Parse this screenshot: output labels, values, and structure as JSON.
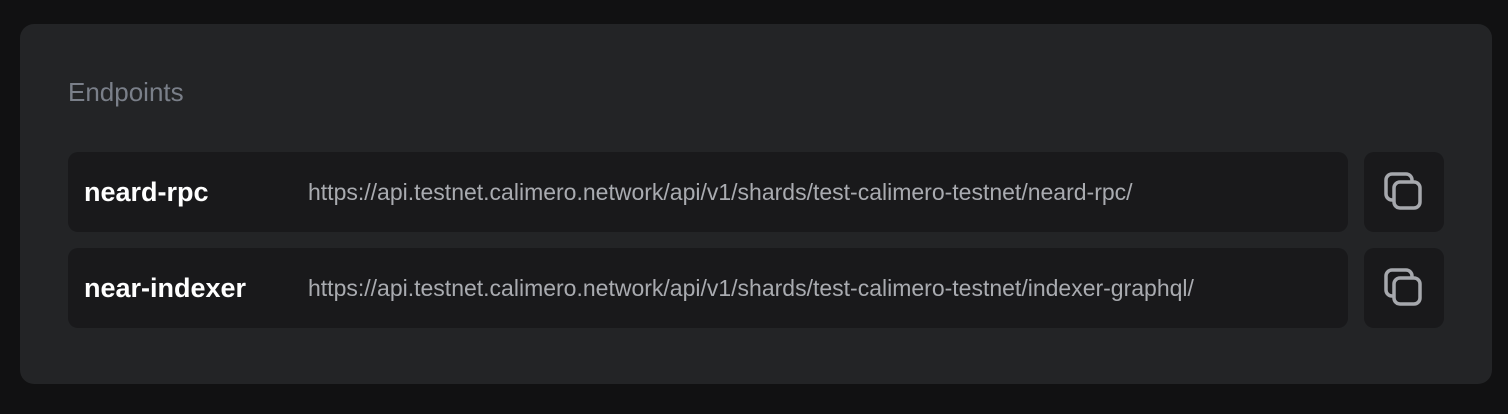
{
  "endpoints": {
    "title": "Endpoints",
    "items": [
      {
        "name": "neard-rpc",
        "url": "https://api.testnet.calimero.network/api/v1/shards/test-calimero-testnet/neard-rpc/",
        "copy_icon": "copy-icon"
      },
      {
        "name": "near-indexer",
        "url": "https://api.testnet.calimero.network/api/v1/shards/test-calimero-testnet/indexer-graphql/",
        "copy_icon": "copy-icon"
      }
    ]
  },
  "colors": {
    "page_background": "#111112",
    "panel_background": "#232426",
    "row_background": "#19191b",
    "title_text": "#7a7f89",
    "name_text": "#ffffff",
    "url_text": "#a9abb0",
    "icon_stroke": "#a6a8ad"
  }
}
